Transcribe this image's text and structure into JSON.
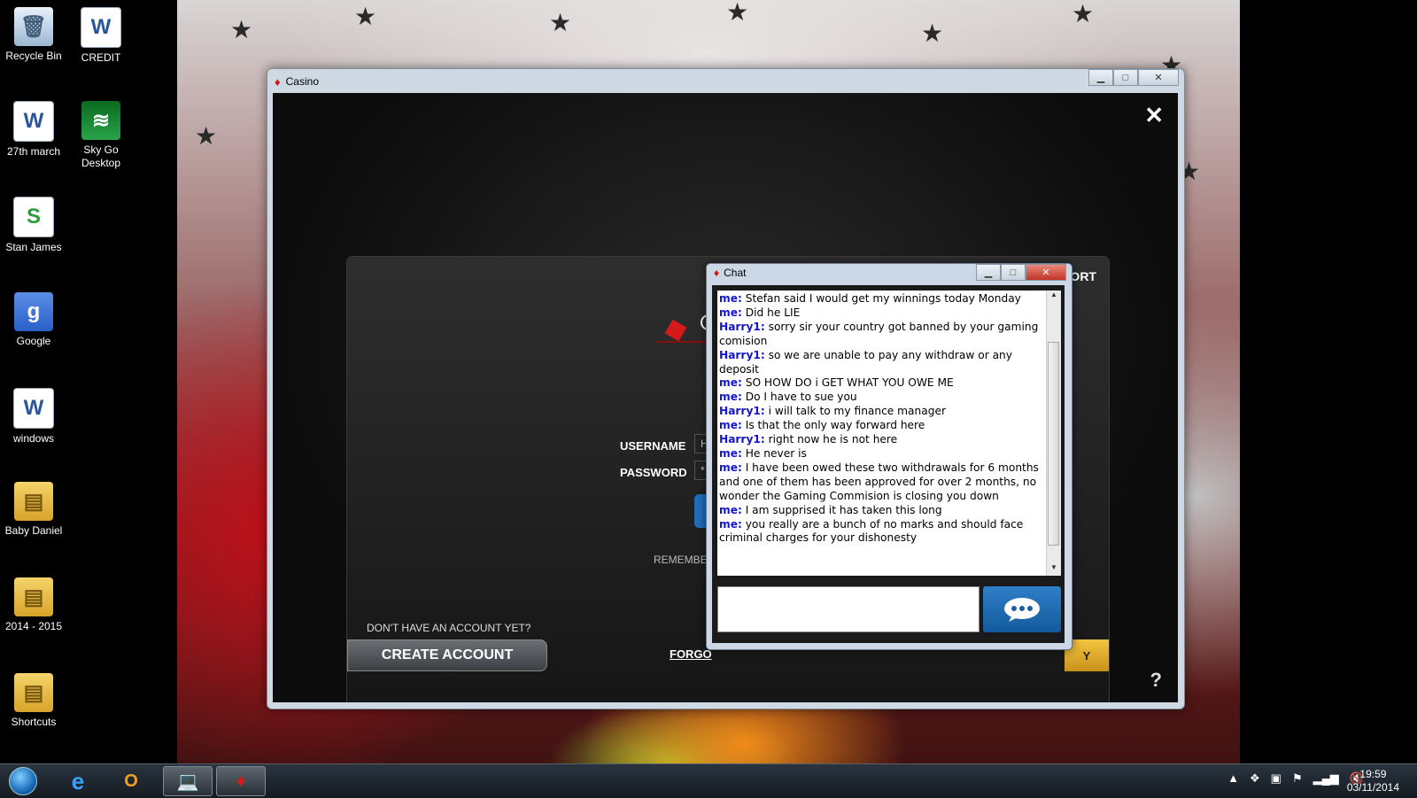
{
  "desktop": {
    "icons": [
      {
        "label": "Recycle Bin"
      },
      {
        "label": "CREDIT"
      },
      {
        "label": "27th march"
      },
      {
        "label": "Sky Go Desktop"
      },
      {
        "label": "Stan James"
      },
      {
        "label": "Google"
      },
      {
        "label": "windows"
      },
      {
        "label": "Baby Daniel"
      },
      {
        "label": "2014 - 2015"
      },
      {
        "label": "Shortcuts"
      }
    ]
  },
  "casino_window": {
    "title": "Casino",
    "online_support": "ONLINE SUPPORT",
    "username_label": "USERNAME",
    "username_value": "H",
    "password_label": "PASSWORD",
    "password_value": "*",
    "remember_label": "REMEMBE",
    "no_account_text": "DON'T HAVE AN ACCOUNT YET?",
    "create_account_label": "CREATE ACCOUNT",
    "forgot_label": "FORGO",
    "play_label": "Y",
    "help_label": "?"
  },
  "chat_window": {
    "title": "Chat",
    "messages": [
      {
        "who": "me:",
        "text": "Stefan said I would get my winnings today Monday"
      },
      {
        "who": "me:",
        "text": "Did he LIE"
      },
      {
        "who": "Harry1:",
        "text": "sorry sir your country got banned by your gaming comision"
      },
      {
        "who": "Harry1:",
        "text": "so we are unable to pay any withdraw or any deposit"
      },
      {
        "who": "me:",
        "text": "SO HOW DO i GET WHAT YOU OWE ME"
      },
      {
        "who": "me:",
        "text": "Do I have to sue you"
      },
      {
        "who": "Harry1:",
        "text": "i will talk to my finance manager"
      },
      {
        "who": "me:",
        "text": "Is that the only way forward here"
      },
      {
        "who": "Harry1:",
        "text": "right now he is not here"
      },
      {
        "who": "me:",
        "text": "He never is"
      },
      {
        "who": "me:",
        "text": "I have been owed these two withdrawals for 6 months and one of them has been approved for over 2 months, no wonder the Gaming Commision is closing you down"
      },
      {
        "who": "me:",
        "text": "I am supprised it has taken this long"
      },
      {
        "who": "me:",
        "text": "you really are a bunch of no marks and should face criminal charges for your dishonesty"
      }
    ],
    "input_value": ""
  },
  "taskbar": {
    "clock_time": "19:59",
    "clock_date": "03/11/2014"
  },
  "colors": {
    "chat_name": "#1414d4",
    "play_button": "#f4c440",
    "send_button": "#2e7fc8"
  }
}
